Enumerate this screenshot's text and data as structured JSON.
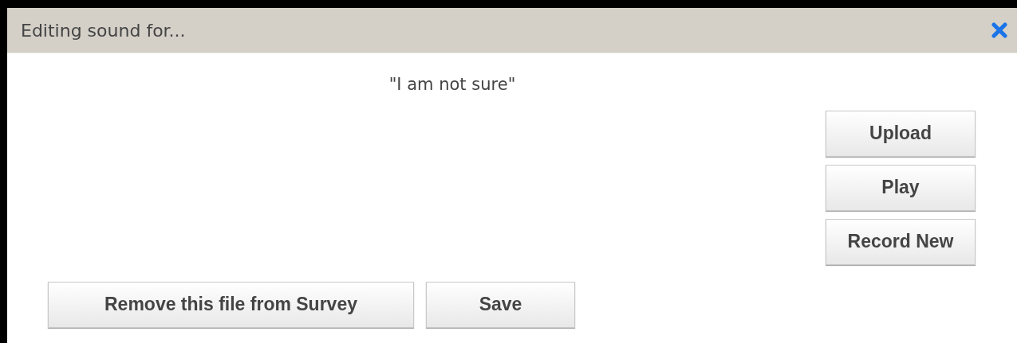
{
  "dialog": {
    "title": "Editing sound for...",
    "phrase": "\"I am not sure\"",
    "side_buttons": [
      "Upload",
      "Play",
      "Record New"
    ],
    "bottom_buttons": [
      "Remove this file from Survey",
      "Save"
    ]
  }
}
